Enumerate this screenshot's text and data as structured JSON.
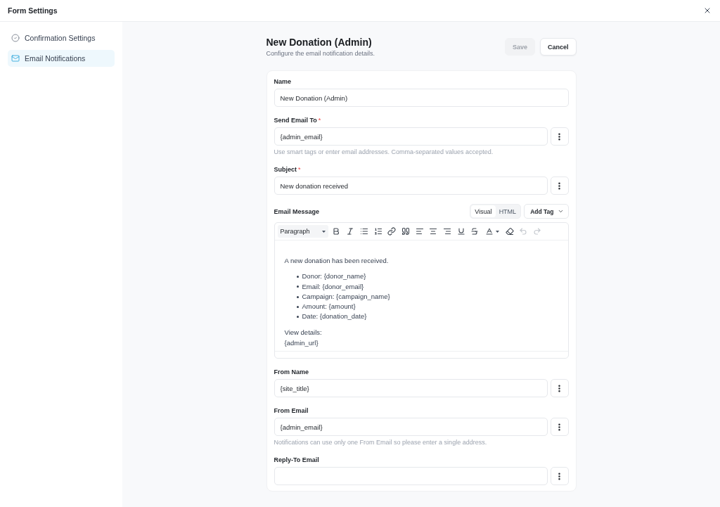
{
  "header": {
    "title": "Form Settings"
  },
  "sidebar": {
    "items": [
      {
        "label": "Confirmation Settings",
        "kind": "confirmation",
        "selected": false
      },
      {
        "label": "Email Notifications",
        "kind": "email",
        "selected": true
      }
    ]
  },
  "page": {
    "title": "New Donation (Admin)",
    "subtitle": "Configure the email notification details.",
    "actions": [
      {
        "label": "Save",
        "kind": "primary",
        "disabled": true
      },
      {
        "label": "Cancel",
        "kind": "secondary",
        "disabled": false
      }
    ]
  },
  "form": {
    "fields": [
      {
        "kind": "text",
        "label": "Name",
        "value": "New Donation (Admin)"
      },
      {
        "kind": "text",
        "label": "Send Email To",
        "required_mark": "*",
        "value": "{admin_email}",
        "menu": true,
        "help": "Use smart tags or enter email addresses. Comma-separated values accepted."
      },
      {
        "kind": "text",
        "label": "Subject",
        "required_mark": "*",
        "value": "New donation received",
        "menu": true
      },
      {
        "kind": "editor",
        "label": "Email Message",
        "modes": [
          {
            "label": "Visual",
            "selected": true
          },
          {
            "label": "HTML",
            "selected": false
          }
        ],
        "add_tag": "Add Tag",
        "format": "Paragraph",
        "toolbar": [
          {
            "kind": "bold",
            "disabled": false
          },
          {
            "kind": "italic",
            "disabled": false
          },
          {
            "kind": "bullet-list",
            "disabled": false
          },
          {
            "kind": "numbered-list",
            "disabled": false
          },
          {
            "kind": "link",
            "disabled": false
          },
          {
            "kind": "quote",
            "disabled": false
          },
          {
            "kind": "align-left",
            "disabled": false
          },
          {
            "kind": "align-center",
            "disabled": false
          },
          {
            "kind": "align-right",
            "disabled": false
          },
          {
            "kind": "underline",
            "disabled": false
          },
          {
            "kind": "strikethrough",
            "disabled": false
          },
          {
            "kind": "text-color",
            "disabled": false
          },
          {
            "kind": "eraser",
            "disabled": false
          },
          {
            "kind": "undo",
            "disabled": true
          },
          {
            "kind": "redo",
            "disabled": true
          }
        ],
        "content": {
          "intro": "A new donation has been received.",
          "items": [
            "Donor: {donor_name}",
            "Email: {donor_email}",
            "Campaign: {campaign_name}",
            "Amount: {amount}",
            "Date: {donation_date}"
          ],
          "outro": [
            "View details:",
            "{admin_url}"
          ]
        }
      },
      {
        "kind": "text",
        "label": "From Name",
        "value": "{site_title}",
        "menu": true
      },
      {
        "kind": "text",
        "label": "From Email",
        "value": "{admin_email}",
        "menu": true,
        "help": "Notifications can use only one From Email so please enter a single address."
      },
      {
        "kind": "text",
        "label": "Reply-To Email",
        "menu": true
      }
    ]
  }
}
